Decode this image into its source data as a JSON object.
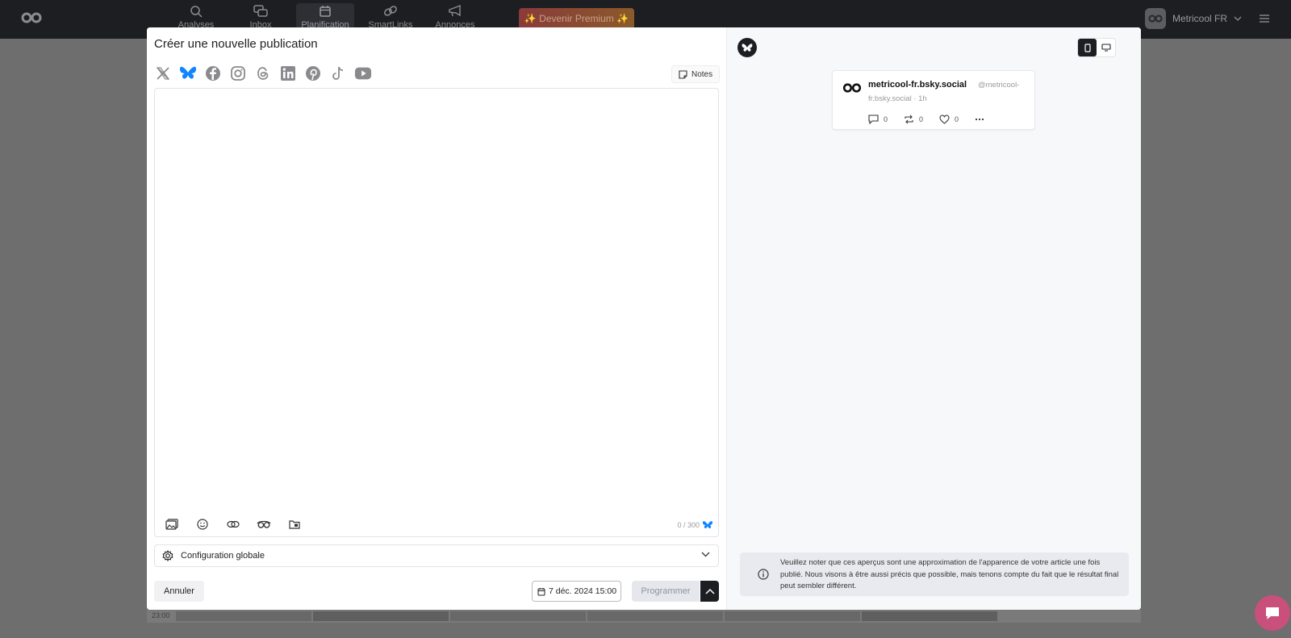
{
  "nav": {
    "items": [
      {
        "label": "Analyses",
        "icon": "analytics-icon"
      },
      {
        "label": "Inbox",
        "icon": "inbox-icon"
      },
      {
        "label": "Planification",
        "icon": "calendar-icon"
      },
      {
        "label": "SmartLinks",
        "icon": "link-icon"
      },
      {
        "label": "Annonces",
        "icon": "megaphone-icon"
      }
    ],
    "premium_label": "✨ Devenir Premium ✨",
    "account_name": "Metricool FR"
  },
  "background": {
    "time_label": "23:00"
  },
  "modal": {
    "title": "Créer une nouvelle publication",
    "networks": [
      "x-icon",
      "bluesky-icon",
      "facebook-icon",
      "instagram-icon",
      "threads-icon",
      "linkedin-icon",
      "pinterest-icon",
      "tiktok-icon",
      "youtube-icon"
    ],
    "notes_label": "Notes",
    "editor": {
      "value": "",
      "counter": "0 / 300"
    },
    "config_label": "Configuration globale",
    "cancel_label": "Annuler",
    "date_label": "7 déc. 2024 15:00",
    "schedule_label": "Programmer"
  },
  "preview": {
    "account_name": "metricool-fr.bsky.social",
    "handle_part1": "@metricool-",
    "handle_part2": "fr.bsky.social · 1h",
    "replies": "0",
    "reposts": "0",
    "likes": "0",
    "notice": "Veuillez noter que ces aperçus sont une approximation de l'apparence de votre article une fois publié. Nous visons à être aussi précis que possible, mais tenons compte du fait que le résultat final peut sembler différent."
  },
  "colors": {
    "accent_bluesky": "#1185fe",
    "dark": "#1d1e22",
    "chat": "#c8507a"
  }
}
